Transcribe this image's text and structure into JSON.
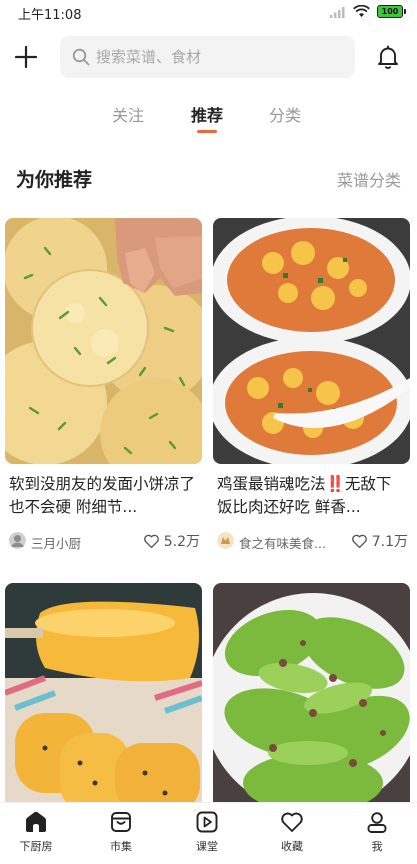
{
  "status_bar": {
    "time": "上午11:08",
    "battery": "100"
  },
  "search": {
    "placeholder": "搜索菜谱、食材"
  },
  "tabs": [
    {
      "label": "关注"
    },
    {
      "label": "推荐"
    },
    {
      "label": "分类"
    }
  ],
  "section": {
    "title": "为你推荐",
    "link": "菜谱分类"
  },
  "cards": [
    {
      "title": "软到没朋友的发面小饼凉了也不会硬 附细节...",
      "author": "三月小厨",
      "likes": "5.2万"
    },
    {
      "title_before": "鸡蛋最销魂吃法",
      "title_mark": "‼️",
      "title_after": "无敌下饭比肉还好吃 鲜香...",
      "author": "食之有味美食...",
      "likes": "7.1万"
    },
    {
      "title": ""
    },
    {
      "title": ""
    }
  ],
  "bottom_nav": [
    {
      "label": "下厨房",
      "icon": "home-icon"
    },
    {
      "label": "市集",
      "icon": "market-icon"
    },
    {
      "label": "课堂",
      "icon": "play-icon"
    },
    {
      "label": "收藏",
      "icon": "heart-icon"
    },
    {
      "label": "我",
      "icon": "user-icon"
    }
  ],
  "colors": {
    "accent": "#f0643a",
    "battery": "#3ec43e"
  }
}
